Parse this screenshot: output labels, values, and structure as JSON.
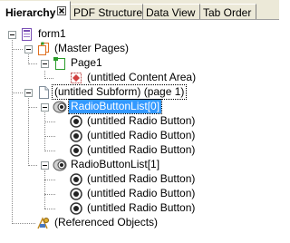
{
  "tabs": [
    {
      "label": "Hierarchy",
      "active": true
    },
    {
      "label": "PDF Structure",
      "active": false
    },
    {
      "label": "Data View",
      "active": false
    },
    {
      "label": "Tab Order",
      "active": false
    }
  ],
  "tree": {
    "form1": "form1",
    "master_pages": "(Master Pages)",
    "page1": "Page1",
    "content_area": "(untitled Content Area)",
    "subform": "(untitled Subform) (page 1)",
    "radio_list_0": "RadioButtonList[0]",
    "radio_list_1": "RadioButtonList[1]",
    "radio_button": "(untitled Radio Button)",
    "referenced_objects": "(Referenced Objects)"
  },
  "selected": "radio_list_0",
  "colors": {
    "selection": "#3399ff",
    "tab_background": "#ece9d8"
  }
}
